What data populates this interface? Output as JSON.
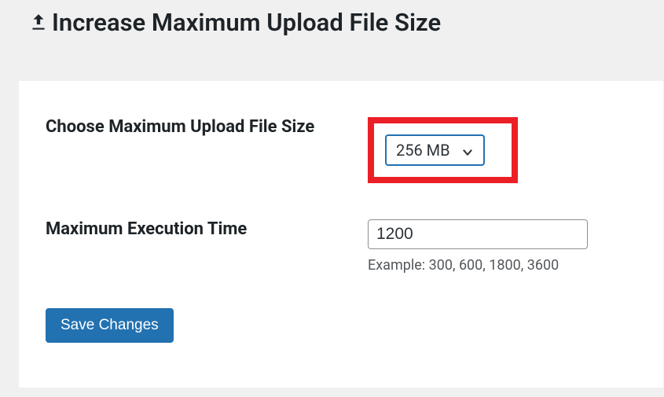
{
  "header": {
    "title": "Increase Maximum Upload File Size"
  },
  "form": {
    "max_upload": {
      "label": "Choose Maximum Upload File Size",
      "selected": "256 MB"
    },
    "max_exec": {
      "label": "Maximum Execution Time",
      "value": "1200",
      "example": "Example: 300, 600, 1800, 3600"
    },
    "save_label": "Save Changes"
  }
}
